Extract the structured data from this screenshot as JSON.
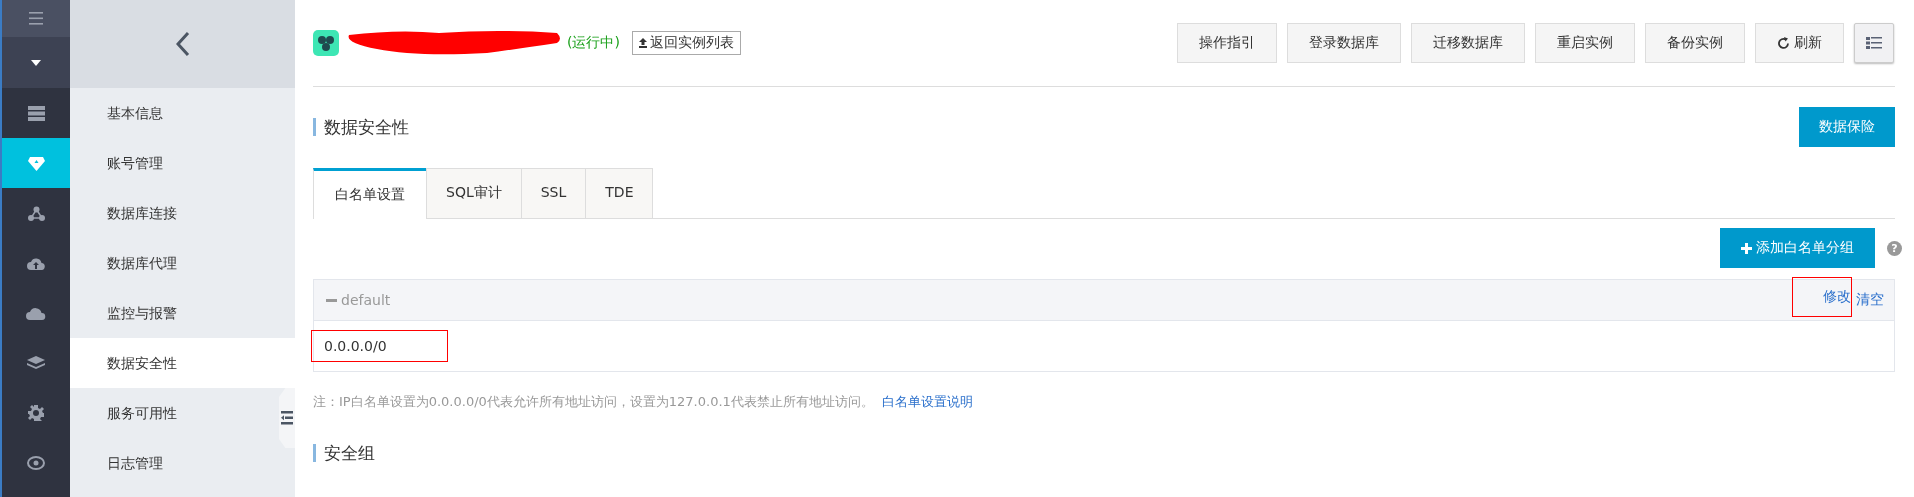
{
  "rail": {
    "items": [
      {
        "kind": "server",
        "selected": false
      },
      {
        "kind": "shield",
        "selected": true
      },
      {
        "kind": "network",
        "selected": false
      },
      {
        "kind": "cloud-up",
        "selected": false
      },
      {
        "kind": "cloud",
        "selected": false
      },
      {
        "kind": "layers",
        "selected": false
      },
      {
        "kind": "gear",
        "selected": false
      },
      {
        "kind": "eye",
        "selected": false
      }
    ]
  },
  "sidebar": {
    "items": [
      {
        "label": "基本信息",
        "selected": false
      },
      {
        "label": "账号管理",
        "selected": false
      },
      {
        "label": "数据库连接",
        "selected": false
      },
      {
        "label": "数据库代理",
        "selected": false
      },
      {
        "label": "监控与报警",
        "selected": false
      },
      {
        "label": "数据安全性",
        "selected": true
      },
      {
        "label": "服务可用性",
        "selected": false
      },
      {
        "label": "日志管理",
        "selected": false
      }
    ]
  },
  "instance": {
    "status": "(运行中)",
    "back_link": "返回实例列表"
  },
  "actions": [
    {
      "label": "操作指引",
      "kind": "text"
    },
    {
      "label": "登录数据库",
      "kind": "text"
    },
    {
      "label": "迁移数据库",
      "kind": "text"
    },
    {
      "label": "重启实例",
      "kind": "text"
    },
    {
      "label": "备份实例",
      "kind": "text"
    },
    {
      "label": "刷新",
      "kind": "refresh"
    }
  ],
  "section_title": "数据安全性",
  "insurance_button": "数据保险",
  "tabs": [
    {
      "label": "白名单设置",
      "selected": true
    },
    {
      "label": "SQL审计",
      "selected": false
    },
    {
      "label": "SSL",
      "selected": false
    },
    {
      "label": "TDE",
      "selected": false
    }
  ],
  "add_button": "添加白名单分组",
  "help": "?",
  "group": {
    "name": "default",
    "expanded": true,
    "actions": [
      {
        "label": "修改",
        "highlighted": true
      },
      {
        "label": "清空",
        "highlighted": false
      }
    ],
    "ips": [
      {
        "value": "0.0.0.0/0",
        "highlighted": true
      }
    ]
  },
  "note": "注：IP白名单设置为0.0.0.0/0代表允许所有地址访问，设置为127.0.0.1代表禁止所有地址访问。",
  "note_link": "白名单设置说明",
  "section2_title": "安全组"
}
